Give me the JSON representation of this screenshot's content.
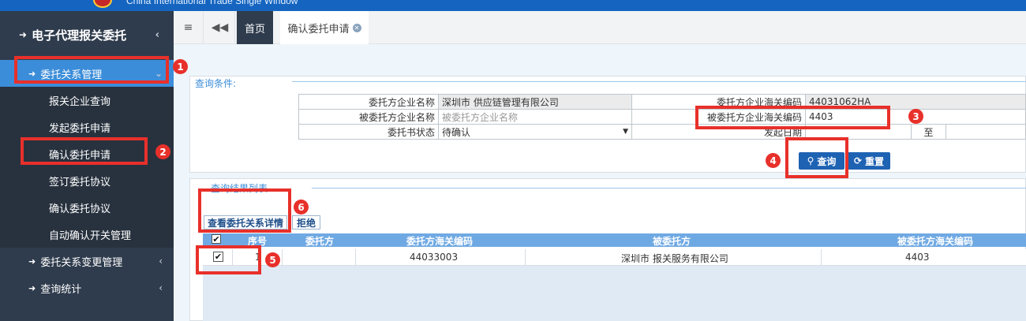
{
  "banner": {
    "brand_text": "China International Trade Single Window"
  },
  "sidebar": {
    "title": "电子代理报关委托",
    "groups": [
      {
        "label": "委托关系管理"
      },
      {
        "label": "委托关系变更管理"
      },
      {
        "label": "查询统计"
      }
    ],
    "sub_items": [
      {
        "label": "报关企业查询"
      },
      {
        "label": "发起委托申请"
      },
      {
        "label": "确认委托申请"
      },
      {
        "label": "签订委托协议"
      },
      {
        "label": "确认委托协议"
      },
      {
        "label": "自动确认开关管理"
      }
    ]
  },
  "tabs": {
    "home": "首页",
    "current": "确认委托申请"
  },
  "query": {
    "legend": "查询条件:",
    "fields": {
      "client_name_label": "委托方企业名称",
      "client_name_value": "深圳市   供应链管理有限公司",
      "client_code_label": "委托方企业海关编码",
      "client_code_value": "44031062HA",
      "agent_name_label": "被委托方企业名称",
      "agent_name_placeholder": "被委托方企业名称",
      "agent_code_label": "被委托方企业海关编码",
      "agent_code_value": "4403         ",
      "status_label": "委托书状态",
      "status_value": "待确认",
      "date_label": "发起日期",
      "date_to": "至"
    },
    "search_button": "查询",
    "reset_button": "重置"
  },
  "results": {
    "legend": "查询结果列表",
    "view_detail_button": "查看委托关系详情",
    "reject_button": "拒绝",
    "columns": [
      "序号",
      "委托方",
      "委托方海关编码",
      "被委托方",
      "被委托方海关编码"
    ],
    "rows": [
      {
        "index": "1",
        "client": "",
        "client_code": "44033003",
        "agent": "深圳市      报关服务有限公司",
        "agent_code": "4403"
      }
    ]
  },
  "annotations": [
    "1",
    "2",
    "3",
    "4",
    "5",
    "6"
  ],
  "colors": {
    "sidebar_bg": "#2f3c4d",
    "active_blue": "#3c8dd9",
    "button_blue": "#1e62b3",
    "annotation_red": "#e8302a"
  }
}
